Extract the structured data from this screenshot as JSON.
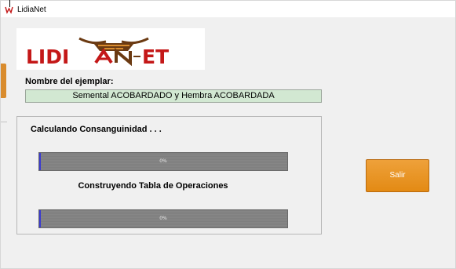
{
  "window": {
    "title": "LidiaNet"
  },
  "logo": {
    "text": "LIDIANET",
    "colors": {
      "red": "#c41818",
      "brown": "#6b3a12",
      "orange": "#d98c2e"
    }
  },
  "specimen": {
    "label": "Nombre del ejemplar:",
    "value": "Semental ACOBARDADO y Hembra ACOBARDADA"
  },
  "progress": {
    "inbreeding_label": "Calculando Consanguinidad . . .",
    "inbreeding_percent": "0%",
    "inbreeding_value": 0,
    "operations_label": "Construyendo Tabla de Operaciones",
    "operations_percent": "0%",
    "operations_value": 0
  },
  "actions": {
    "exit_label": "Salir"
  },
  "colors": {
    "accent_orange": "#e8941f",
    "field_green": "#d2e8d2",
    "progress_gray": "#7f7f7f",
    "progress_lead": "#3a3ad0"
  }
}
